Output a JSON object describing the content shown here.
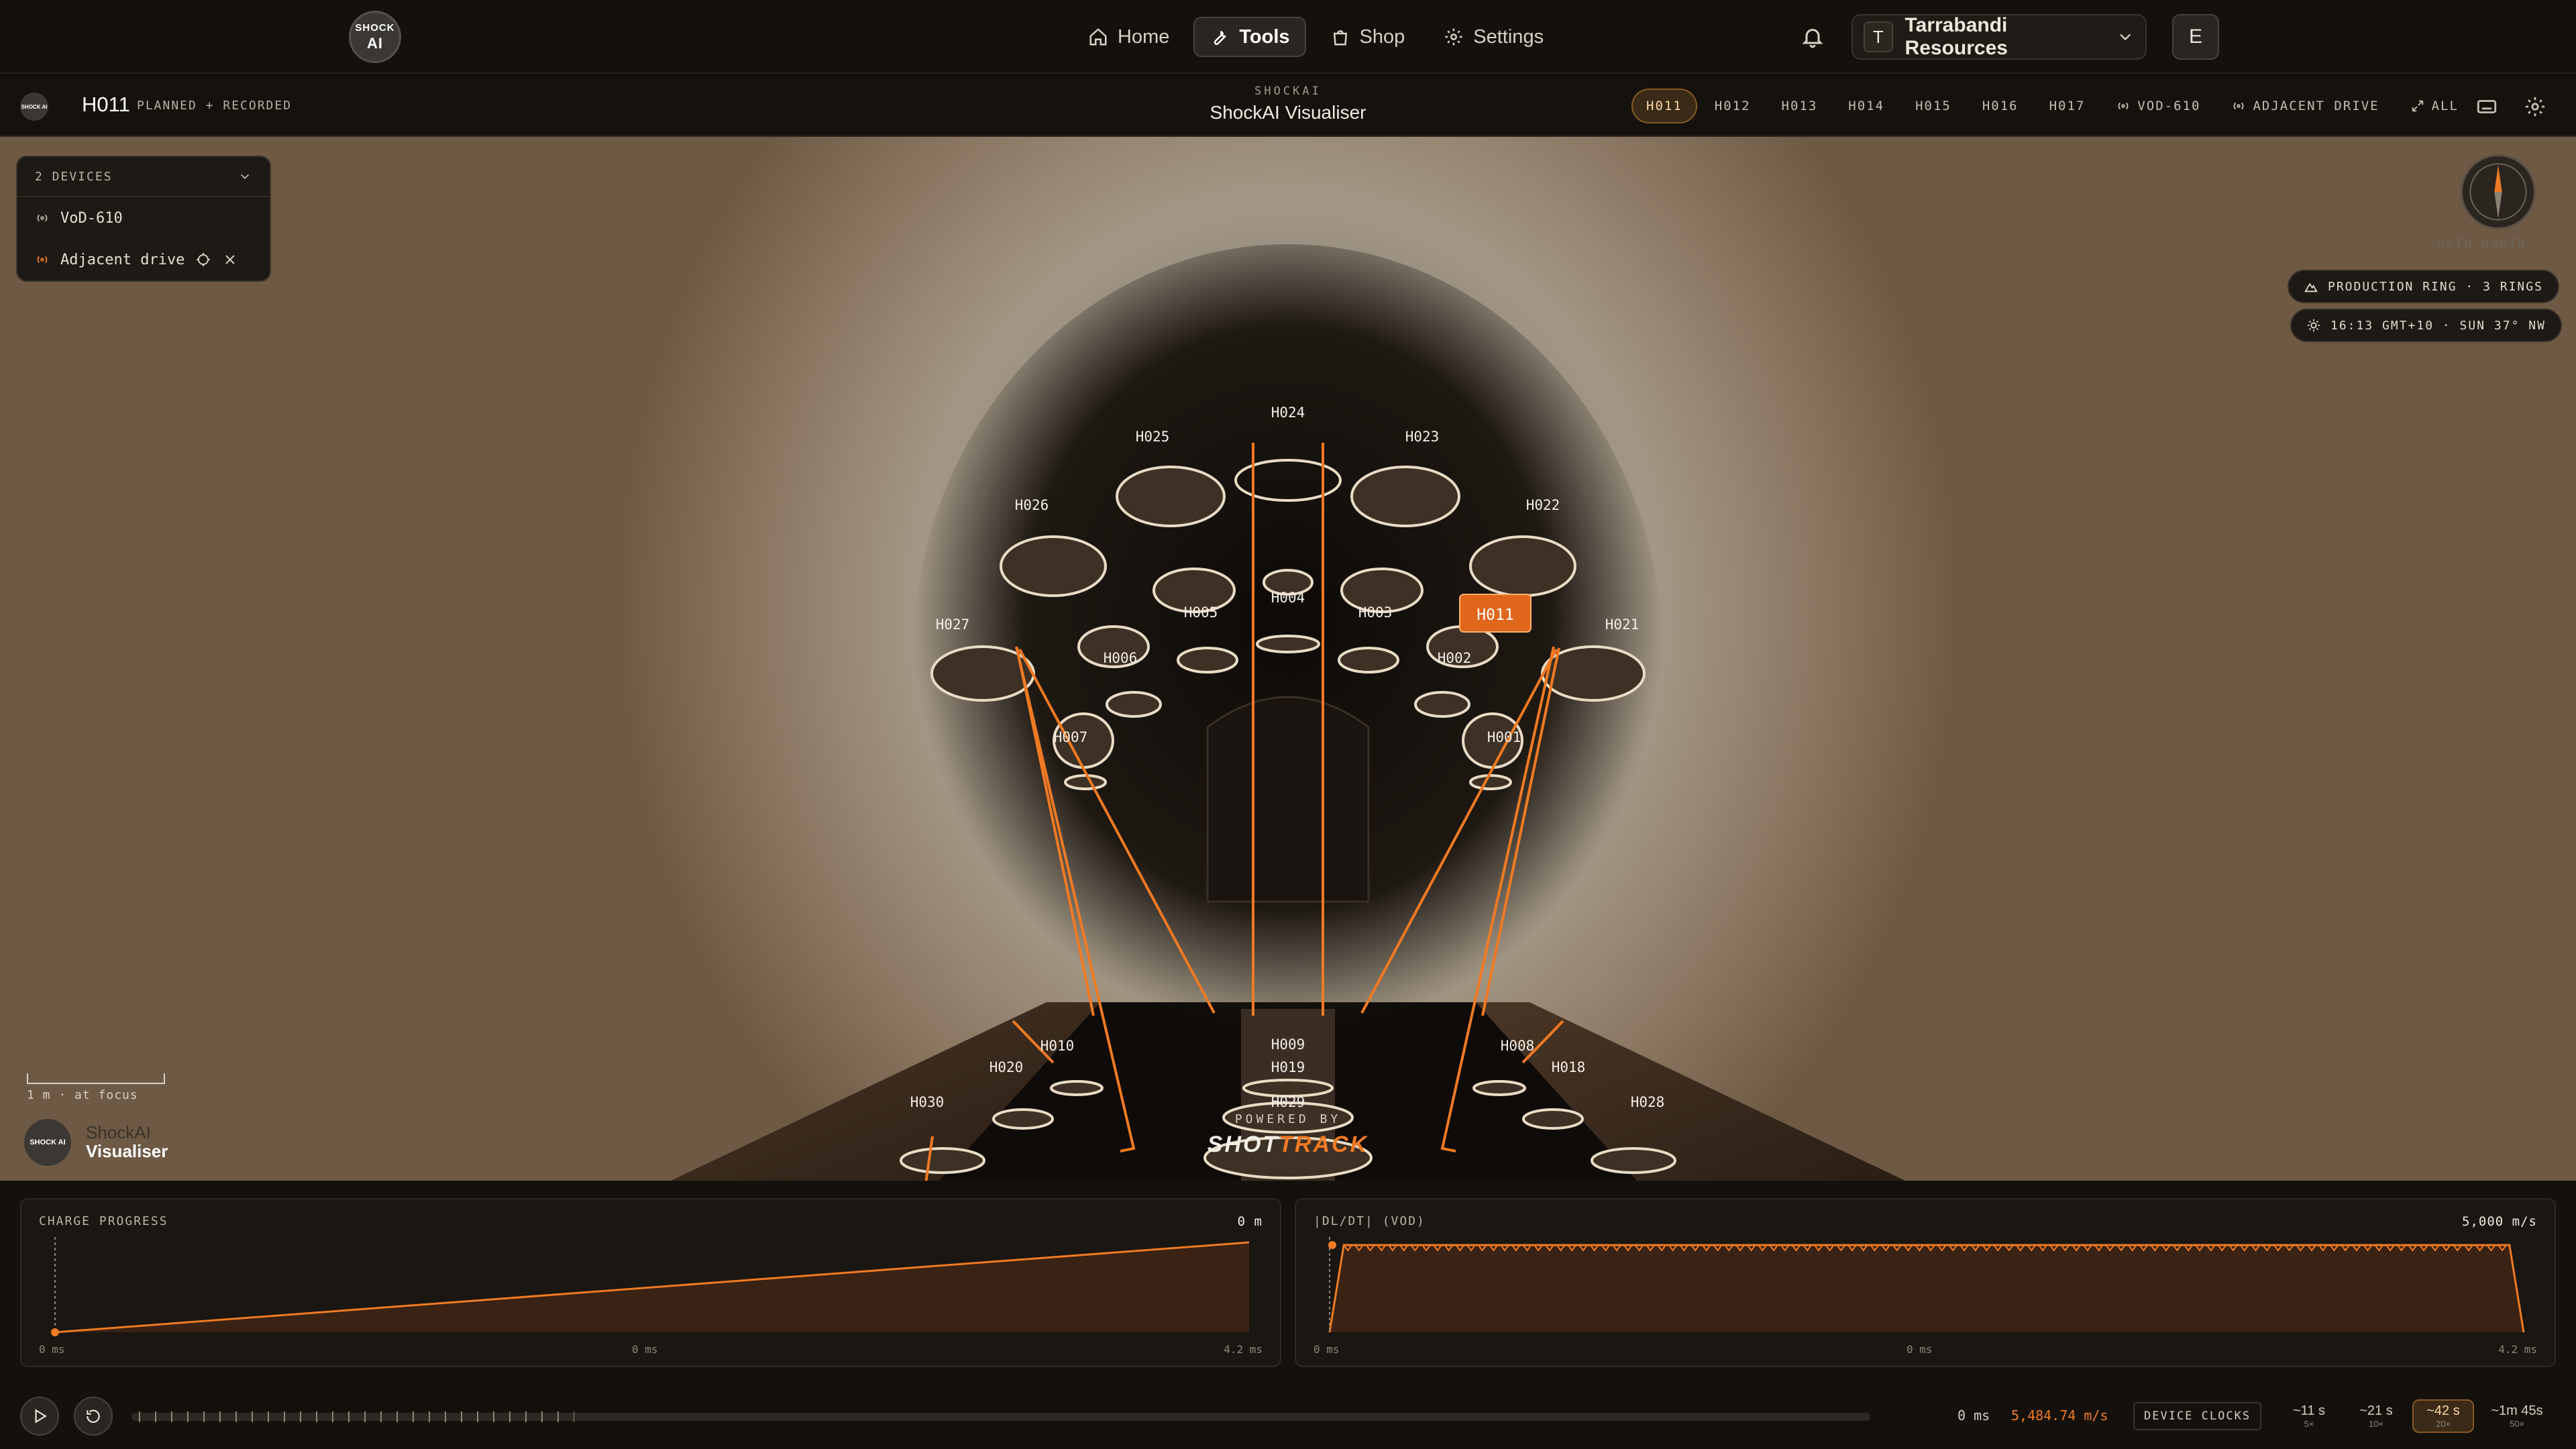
{
  "topnav": {
    "logo": {
      "line1": "SHOCK",
      "line2": "AI"
    },
    "links": [
      {
        "label": "Home",
        "icon": "home-icon"
      },
      {
        "label": "Tools",
        "icon": "wrench-icon",
        "active": true
      },
      {
        "label": "Shop",
        "icon": "bag-icon"
      },
      {
        "label": "Settings",
        "icon": "gear-icon"
      }
    ],
    "org": {
      "initial": "T",
      "name": "Tarrabandi Resources"
    },
    "user_initial": "E"
  },
  "subheader": {
    "logo_text": "SHOCK AI",
    "hole": "H011",
    "status": "PLANNED + RECORDED",
    "brand": "SHOCKAI",
    "app": "ShockAI Visualiser",
    "chips": [
      {
        "label": "H011",
        "active": true
      },
      {
        "label": "H012"
      },
      {
        "label": "H013"
      },
      {
        "label": "H014"
      },
      {
        "label": "H015"
      },
      {
        "label": "H016"
      },
      {
        "label": "H017"
      },
      {
        "label": "VOD-610",
        "icon": "signal-icon"
      },
      {
        "label": "ADJACENT DRIVE",
        "icon": "signal-icon"
      },
      {
        "label": "ALL",
        "icon": "expand-icon"
      }
    ]
  },
  "devices": {
    "header": "2 DEVICES",
    "items": [
      {
        "label": "VoD-610",
        "color": "#bdb4a6"
      },
      {
        "label": "Adjacent drive",
        "color": "#f07a23"
      }
    ]
  },
  "compass": {
    "label": "GRID NORTH"
  },
  "ring_pill": "PRODUCTION RING · 3 RINGS",
  "time_pill": "16:13 GMT+10 · SUN 37° NW",
  "scale_label": "1 m · at focus",
  "bottom_logo": {
    "text": "SHOCK AI",
    "line1": "ShockAI",
    "line2": "Visualiser"
  },
  "powered": {
    "line1": "POWERED BY",
    "brand_a": "SHOT",
    "brand_b": "TRACK"
  },
  "holes": {
    "selected": "H011",
    "labels": [
      "H024",
      "H025",
      "H023",
      "H026",
      "H022",
      "H027",
      "H021",
      "H005",
      "H004",
      "H003",
      "H006",
      "H002",
      "H007",
      "H001",
      "H010",
      "H009",
      "H008",
      "H020",
      "H019",
      "H018",
      "H030",
      "H029",
      "H028"
    ]
  },
  "charts": {
    "charge": {
      "title": "CHARGE PROGRESS",
      "value": "0 m",
      "ticks": [
        "0 ms",
        "0 ms",
        "4.2 ms"
      ]
    },
    "dldt": {
      "title": "|DL/DT| (VOD)",
      "value": "5,000 m/s",
      "ticks": [
        "0 ms",
        "0 ms",
        "4.2 ms"
      ]
    }
  },
  "chart_data": [
    {
      "type": "area",
      "title": "CHARGE PROGRESS",
      "x": [
        0,
        4.2
      ],
      "y": [
        0,
        1
      ],
      "xlabel": "",
      "ylabel": ""
    },
    {
      "type": "line",
      "title": "|DL/DT| (VOD)",
      "x": [
        0,
        0.05,
        4.15,
        4.2
      ],
      "y": [
        0,
        5000,
        5000,
        0
      ],
      "xlabel": "",
      "ylabel": ""
    }
  ],
  "timeline": {
    "time": "0 ms",
    "speed": "5,484.74 m/s",
    "clocks_label": "DEVICE CLOCKS",
    "zoom": [
      {
        "t": "~11 s",
        "m": "5×"
      },
      {
        "t": "~21 s",
        "m": "10×"
      },
      {
        "t": "~42 s",
        "m": "20×",
        "active": true
      },
      {
        "t": "~1m 45s",
        "m": "50×"
      }
    ]
  },
  "colors": {
    "accent": "#f07a23",
    "bg": "#14110d"
  }
}
